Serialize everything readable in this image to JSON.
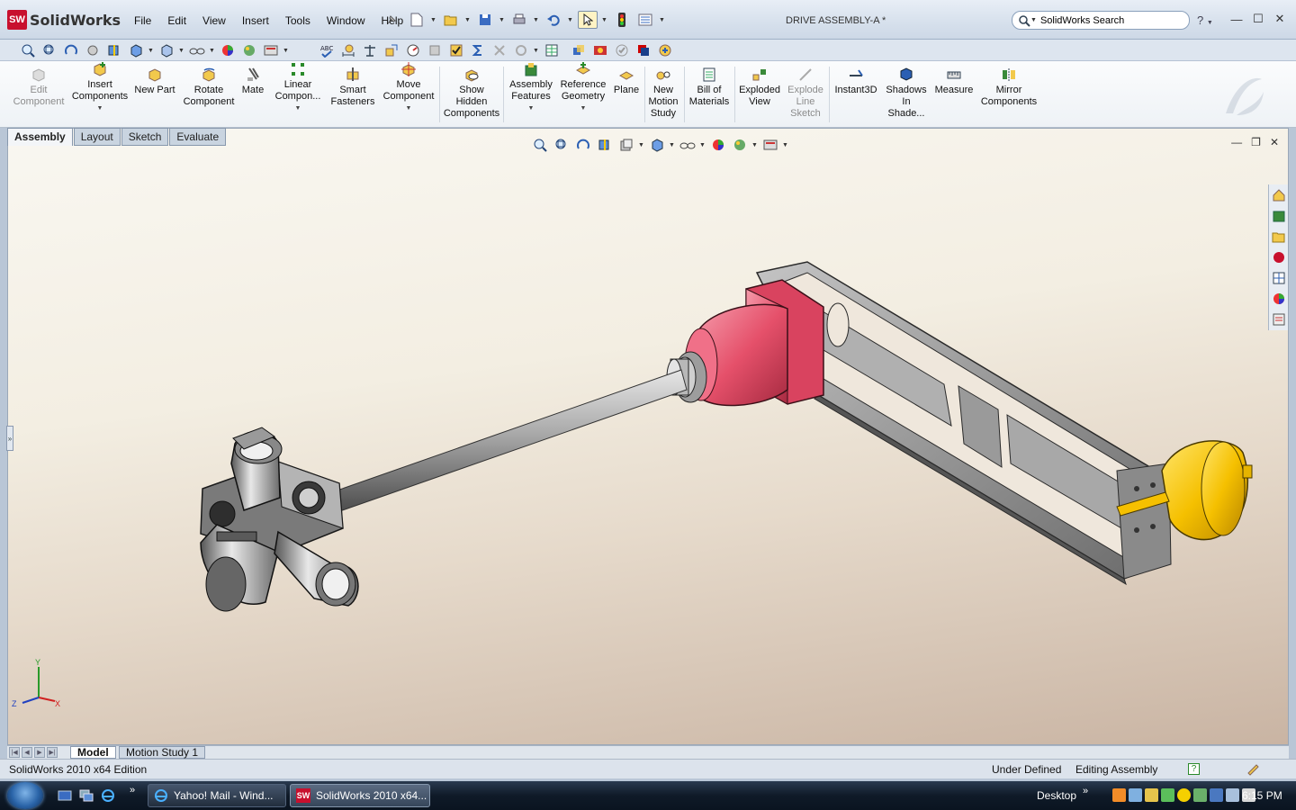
{
  "app": {
    "logo_mark": "SW",
    "logo_text": "SolidWorks",
    "document_title": "DRIVE ASSEMBLY-A *"
  },
  "menu": [
    "File",
    "Edit",
    "View",
    "Insert",
    "Tools",
    "Window",
    "Help"
  ],
  "search": {
    "value": "SolidWorks Search",
    "help": "?"
  },
  "commands": [
    {
      "label": "Edit Component",
      "icon": "edit-component-icon",
      "enabled": false
    },
    {
      "label": "Insert Components",
      "icon": "insert-components-icon",
      "enabled": true
    },
    {
      "label": "New Part",
      "icon": "new-part-icon",
      "enabled": true
    },
    {
      "label": "Rotate Component",
      "icon": "rotate-component-icon",
      "enabled": true
    },
    {
      "label": "Mate",
      "icon": "mate-icon",
      "enabled": true
    },
    {
      "label": "Linear Compon...",
      "icon": "linear-pattern-icon",
      "enabled": true
    },
    {
      "label": "Smart Fasteners",
      "icon": "smart-fasteners-icon",
      "enabled": true
    },
    {
      "label": "Move Component",
      "icon": "move-component-icon",
      "enabled": true
    },
    {
      "label": "Show Hidden Components",
      "icon": "show-hidden-icon",
      "enabled": true
    },
    {
      "label": "Assembly Features",
      "icon": "assembly-features-icon",
      "enabled": true
    },
    {
      "label": "Reference Geometry",
      "icon": "reference-geometry-icon",
      "enabled": true
    },
    {
      "label": "Plane",
      "icon": "plane-icon",
      "enabled": true
    },
    {
      "label": "New Motion Study",
      "icon": "motion-study-icon",
      "enabled": true
    },
    {
      "label": "Bill of Materials",
      "icon": "bom-icon",
      "enabled": true
    },
    {
      "label": "Exploded View",
      "icon": "exploded-view-icon",
      "enabled": true
    },
    {
      "label": "Explode Line Sketch",
      "icon": "explode-line-icon",
      "enabled": false
    },
    {
      "label": "Instant3D",
      "icon": "instant3d-icon",
      "enabled": true
    },
    {
      "label": "Shadows In Shade...",
      "icon": "shadows-icon",
      "enabled": true
    },
    {
      "label": "Measure",
      "icon": "measure-icon",
      "enabled": true
    },
    {
      "label": "Mirror Components",
      "icon": "mirror-components-icon",
      "enabled": true
    }
  ],
  "tabs": [
    "Assembly",
    "Layout",
    "Sketch",
    "Evaluate"
  ],
  "bottom_tabs": [
    "Model",
    "Motion Study 1"
  ],
  "triad": {
    "x": "X",
    "y": "Y",
    "z": "Z"
  },
  "status": {
    "edition": "SolidWorks 2010 x64 Edition",
    "state": "Under Defined",
    "mode": "Editing Assembly",
    "help_badge": "?"
  },
  "taskbar": {
    "tasks": [
      {
        "label": "Yahoo! Mail - Wind...",
        "icon": "ie-icon"
      },
      {
        "label": "SolidWorks 2010 x64...",
        "icon": "solidworks-icon"
      }
    ],
    "desktop": "Desktop",
    "chevron": "»",
    "clock": "6:15 PM"
  },
  "colors": {
    "motor_red": "#e5506a",
    "motor_yellow": "#f5c000",
    "frame_gray": "#8e8e8e",
    "brand_red": "#c8102e"
  }
}
